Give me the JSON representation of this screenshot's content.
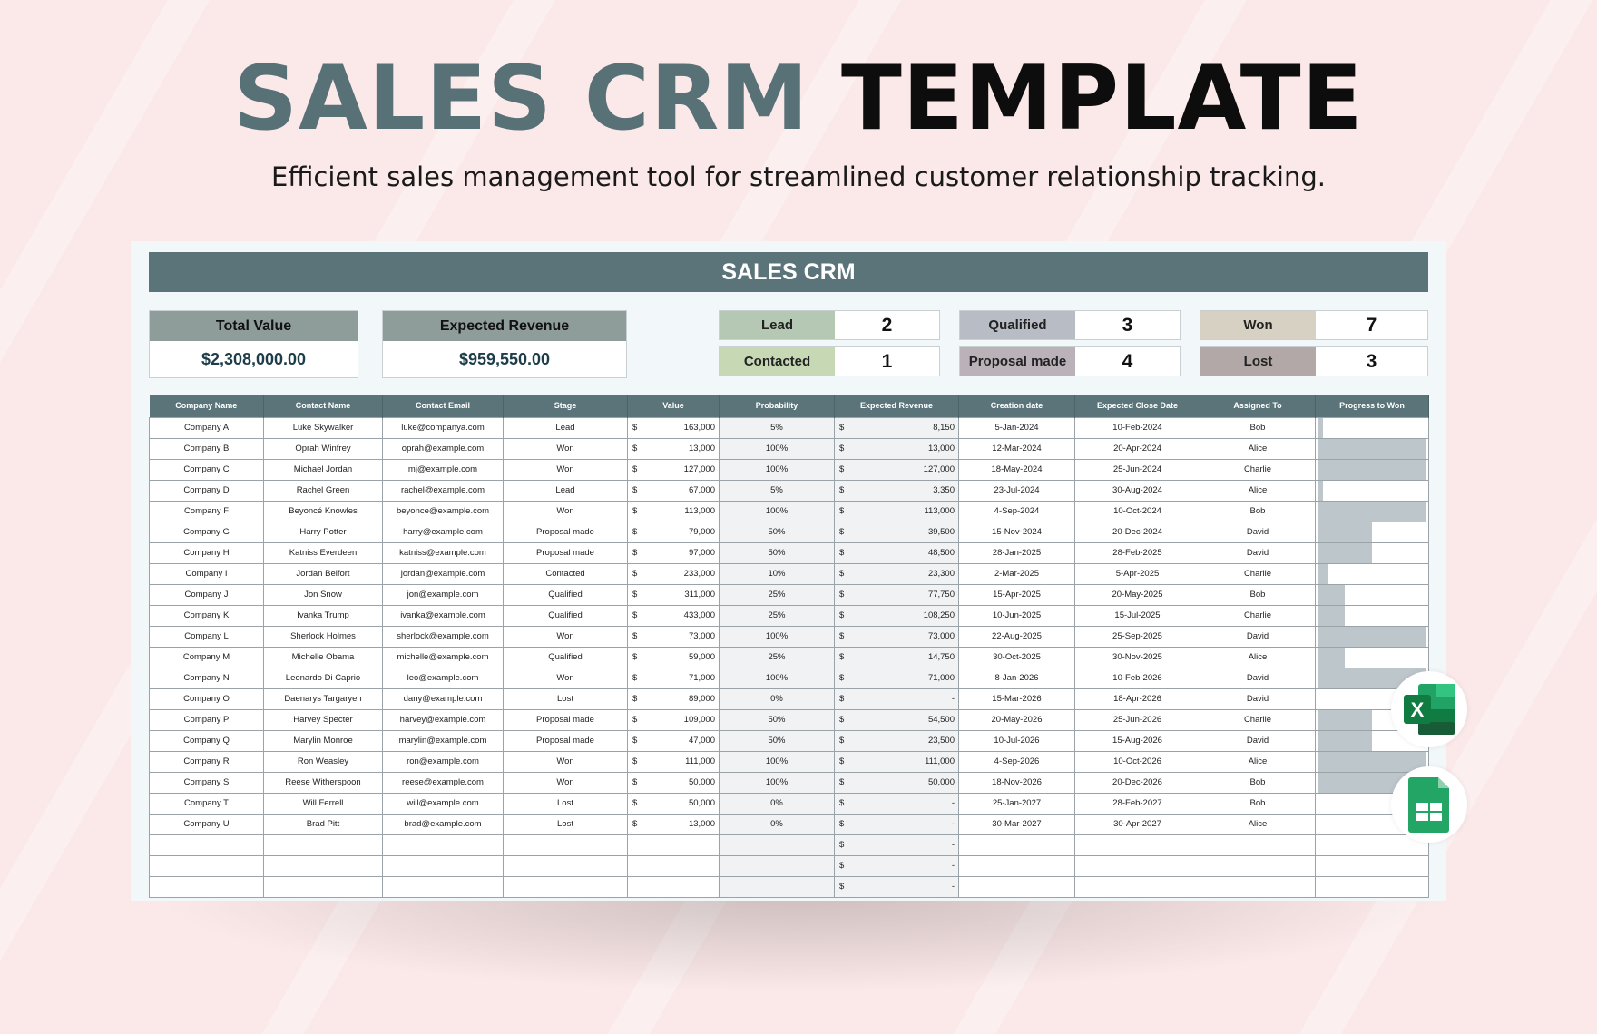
{
  "hero": {
    "title_a": "SALES CRM",
    "title_b": "TEMPLATE",
    "subtitle": "Efficient sales management tool for streamlined customer relationship tracking."
  },
  "sheet": {
    "title": "SALES CRM",
    "summary": [
      {
        "label": "Total Value",
        "value": "$2,308,000.00"
      },
      {
        "label": "Expected Revenue",
        "value": "$959,550.00"
      }
    ],
    "stages": [
      {
        "label": "Lead",
        "count": "2",
        "color": "#b4c8b4"
      },
      {
        "label": "Contacted",
        "count": "1",
        "color": "#c7d8b5"
      },
      {
        "label": "Qualified",
        "count": "3",
        "color": "#b8bcc4"
      },
      {
        "label": "Proposal made",
        "count": "4",
        "color": "#bab2b8"
      },
      {
        "label": "Won",
        "count": "7",
        "color": "#d6d1c3"
      },
      {
        "label": "Lost",
        "count": "3",
        "color": "#b2a8a8"
      }
    ],
    "columns": [
      "Company Name",
      "Contact Name",
      "Contact Email",
      "Stage",
      "Value",
      "Probability",
      "Expected Revenue",
      "Creation date",
      "Expected Close Date",
      "Assigned To",
      "Progress to Won"
    ],
    "currency": "$",
    "rows": [
      [
        "Company A",
        "Luke Skywalker",
        "luke@companya.com",
        "Lead",
        "163,000",
        "5%",
        "8,150",
        "5-Jan-2024",
        "10-Feb-2024",
        "Bob",
        0.05
      ],
      [
        "Company B",
        "Oprah Winfrey",
        "oprah@example.com",
        "Won",
        "13,000",
        "100%",
        "13,000",
        "12-Mar-2024",
        "20-Apr-2024",
        "Alice",
        1
      ],
      [
        "Company C",
        "Michael Jordan",
        "mj@example.com",
        "Won",
        "127,000",
        "100%",
        "127,000",
        "18-May-2024",
        "25-Jun-2024",
        "Charlie",
        1
      ],
      [
        "Company D",
        "Rachel Green",
        "rachel@example.com",
        "Lead",
        "67,000",
        "5%",
        "3,350",
        "23-Jul-2024",
        "30-Aug-2024",
        "Alice",
        0.05
      ],
      [
        "Company F",
        "Beyoncé Knowles",
        "beyonce@example.com",
        "Won",
        "113,000",
        "100%",
        "113,000",
        "4-Sep-2024",
        "10-Oct-2024",
        "Bob",
        1
      ],
      [
        "Company G",
        "Harry Potter",
        "harry@example.com",
        "Proposal made",
        "79,000",
        "50%",
        "39,500",
        "15-Nov-2024",
        "20-Dec-2024",
        "David",
        0.5
      ],
      [
        "Company H",
        "Katniss Everdeen",
        "katniss@example.com",
        "Proposal made",
        "97,000",
        "50%",
        "48,500",
        "28-Jan-2025",
        "28-Feb-2025",
        "David",
        0.5
      ],
      [
        "Company I",
        "Jordan Belfort",
        "jordan@example.com",
        "Contacted",
        "233,000",
        "10%",
        "23,300",
        "2-Mar-2025",
        "5-Apr-2025",
        "Charlie",
        0.1
      ],
      [
        "Company J",
        "Jon Snow",
        "jon@example.com",
        "Qualified",
        "311,000",
        "25%",
        "77,750",
        "15-Apr-2025",
        "20-May-2025",
        "Bob",
        0.25
      ],
      [
        "Company K",
        "Ivanka Trump",
        "ivanka@example.com",
        "Qualified",
        "433,000",
        "25%",
        "108,250",
        "10-Jun-2025",
        "15-Jul-2025",
        "Charlie",
        0.25
      ],
      [
        "Company L",
        "Sherlock Holmes",
        "sherlock@example.com",
        "Won",
        "73,000",
        "100%",
        "73,000",
        "22-Aug-2025",
        "25-Sep-2025",
        "David",
        1
      ],
      [
        "Company M",
        "Michelle Obama",
        "michelle@example.com",
        "Qualified",
        "59,000",
        "25%",
        "14,750",
        "30-Oct-2025",
        "30-Nov-2025",
        "Alice",
        0.25
      ],
      [
        "Company N",
        "Leonardo Di Caprio",
        "leo@example.com",
        "Won",
        "71,000",
        "100%",
        "71,000",
        "8-Jan-2026",
        "10-Feb-2026",
        "David",
        1
      ],
      [
        "Company O",
        "Daenarys Targaryen",
        "dany@example.com",
        "Lost",
        "89,000",
        "0%",
        "-",
        "15-Mar-2026",
        "18-Apr-2026",
        "David",
        0
      ],
      [
        "Company P",
        "Harvey Specter",
        "harvey@example.com",
        "Proposal made",
        "109,000",
        "50%",
        "54,500",
        "20-May-2026",
        "25-Jun-2026",
        "Charlie",
        0.5
      ],
      [
        "Company Q",
        "Marylin Monroe",
        "marylin@example.com",
        "Proposal made",
        "47,000",
        "50%",
        "23,500",
        "10-Jul-2026",
        "15-Aug-2026",
        "David",
        0.5
      ],
      [
        "Company R",
        "Ron Weasley",
        "ron@example.com",
        "Won",
        "111,000",
        "100%",
        "111,000",
        "4-Sep-2026",
        "10-Oct-2026",
        "Alice",
        1
      ],
      [
        "Company S",
        "Reese Witherspoon",
        "reese@example.com",
        "Won",
        "50,000",
        "100%",
        "50,000",
        "18-Nov-2026",
        "20-Dec-2026",
        "Bob",
        1
      ],
      [
        "Company T",
        "Will Ferrell",
        "will@example.com",
        "Lost",
        "50,000",
        "0%",
        "-",
        "25-Jan-2027",
        "28-Feb-2027",
        "Bob",
        0
      ],
      [
        "Company U",
        "Brad Pitt",
        "brad@example.com",
        "Lost",
        "13,000",
        "0%",
        "-",
        "30-Mar-2027",
        "30-Apr-2027",
        "Alice",
        0
      ],
      [
        "",
        "",
        "",
        "",
        "",
        "",
        "-",
        "",
        "",
        "",
        null
      ],
      [
        "",
        "",
        "",
        "",
        "",
        "",
        "-",
        "",
        "",
        "",
        null
      ],
      [
        "",
        "",
        "",
        "",
        "",
        "",
        "-",
        "",
        "",
        "",
        null
      ]
    ],
    "colors": {
      "header": "#5a7479",
      "progress_fill": "#bcc6cb",
      "title_accent": "#587177"
    }
  },
  "app_icons": [
    "excel-icon",
    "google-sheets-icon"
  ]
}
